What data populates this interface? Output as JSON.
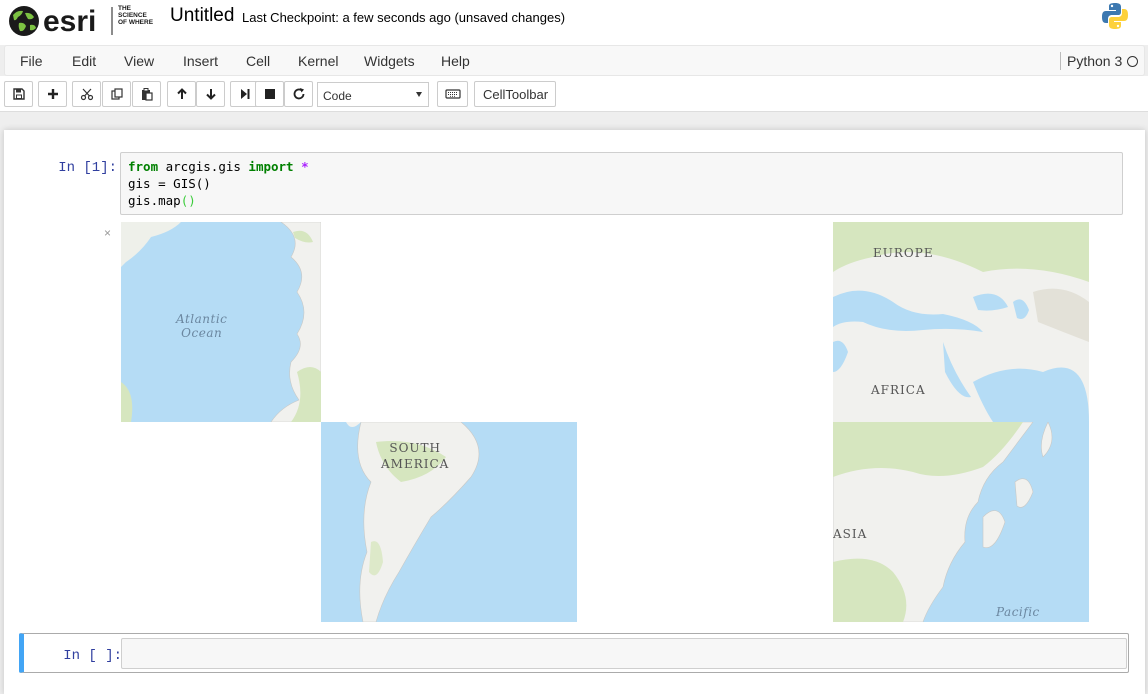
{
  "header": {
    "brand_name": "esri",
    "brand_tagline": "THE SCIENCE OF WHERE",
    "notebook_title": "Untitled",
    "checkpoint_status": "Last Checkpoint: a few seconds ago (unsaved changes)",
    "python_logo_icon": "python-logo-icon"
  },
  "menubar": {
    "items": [
      "File",
      "Edit",
      "View",
      "Insert",
      "Cell",
      "Kernel",
      "Widgets",
      "Help"
    ],
    "kernel_name": "Python 3",
    "kernel_status_icon": "kernel-idle-circle-icon"
  },
  "toolbar": {
    "buttons": [
      {
        "name": "save",
        "icon": "floppy-disk-icon"
      },
      {
        "name": "insert-cell-below",
        "icon": "plus-icon"
      },
      {
        "name": "cut",
        "icon": "scissors-icon"
      },
      {
        "name": "copy",
        "icon": "copy-icon"
      },
      {
        "name": "paste",
        "icon": "paste-icon"
      },
      {
        "name": "move-up",
        "icon": "arrow-up-icon"
      },
      {
        "name": "move-down",
        "icon": "arrow-down-icon"
      },
      {
        "name": "run",
        "icon": "step-forward-icon"
      },
      {
        "name": "interrupt",
        "icon": "stop-icon"
      },
      {
        "name": "restart",
        "icon": "refresh-icon"
      },
      {
        "name": "command-palette",
        "icon": "keyboard-icon"
      }
    ],
    "cell_type_selected": "Code",
    "celltoolbar_label": "CellToolbar"
  },
  "cells": [
    {
      "prompt": "In [1]:",
      "code_lines": [
        [
          {
            "t": "from",
            "c": "kw"
          },
          {
            "t": " arcgis.gis ",
            "c": ""
          },
          {
            "t": "import",
            "c": "kw"
          },
          {
            "t": " ",
            "c": ""
          },
          {
            "t": "*",
            "c": "op"
          }
        ],
        [
          {
            "t": "gis ",
            "c": ""
          },
          {
            "t": "=",
            "c": ""
          },
          {
            "t": " GIS()",
            "c": ""
          }
        ],
        [
          {
            "t": "gis.map",
            "c": ""
          },
          {
            "t": "()",
            "c": "paren"
          }
        ]
      ],
      "output": {
        "close_glyph": "×",
        "map_labels": {
          "atlantic": "Atlantic\nOcean",
          "europe": "EUROPE",
          "africa": "AFRICA",
          "south_america": "SOUTH\nAMERICA",
          "asia": "ASIA",
          "pacific": "Pacific"
        },
        "colors": {
          "ocean": "#b5dcf5",
          "land": "#f1f1ee",
          "vegetation": "#d6e6bf",
          "border": "#c9c9c6"
        }
      }
    },
    {
      "prompt": "In [ ]:",
      "code_lines": []
    }
  ]
}
